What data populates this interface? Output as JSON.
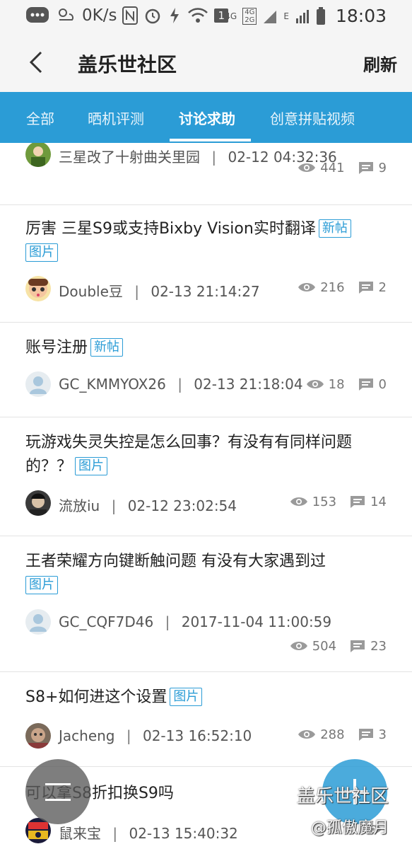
{
  "status_bar": {
    "speed": "0K/s",
    "sim_badge": "1",
    "net_4g": "4G",
    "net_4g_small": "4G",
    "net_2g_small": "2G",
    "net_e": "E",
    "time": "18:03"
  },
  "appbar": {
    "title": "盖乐世社区",
    "refresh_label": "刷新"
  },
  "tabs": [
    {
      "label": "全部",
      "active": false
    },
    {
      "label": "晒机评测",
      "active": false
    },
    {
      "label": "讨论求助",
      "active": true
    },
    {
      "label": "创意拼贴视频",
      "active": false
    }
  ],
  "posts": [
    {
      "title": "",
      "tags": [],
      "author": "三星改了十射曲关里园",
      "time": "02-12 04:32:36",
      "views": "441",
      "comments": "9"
    },
    {
      "title": "厉害 三星S9或支持Bixby Vision实时翻译",
      "tags": [
        "新帖",
        "图片"
      ],
      "author": "Double豆",
      "time": "02-13 21:14:27",
      "views": "216",
      "comments": "2"
    },
    {
      "title": "账号注册",
      "tags": [
        "新帖"
      ],
      "author": "GC_KMMYOX26",
      "time": "02-13 21:18:04",
      "views": "18",
      "comments": "0"
    },
    {
      "title": "玩游戏失灵失控是怎么回事？有没有有同样问题的？？",
      "tags": [
        "图片"
      ],
      "author": "流放iu",
      "time": "02-12 23:02:54",
      "views": "153",
      "comments": "14"
    },
    {
      "title": "王者荣耀方向键断触问题 有没有大家遇到过",
      "tags": [
        "图片"
      ],
      "author": "GC_CQF7D46",
      "time": "2017-11-04 11:00:59",
      "views": "504",
      "comments": "23"
    },
    {
      "title": "S8+如何进这个设置",
      "tags": [
        "图片"
      ],
      "author": "Jacheng",
      "time": "02-13 16:52:10",
      "views": "288",
      "comments": "3"
    },
    {
      "title": "可以拿S8折扣换S9吗",
      "tags": [],
      "author": "鼠来宝",
      "time": "02-13 15:40:32",
      "views": "",
      "comments": ""
    }
  ],
  "separator": "|",
  "watermark": {
    "line1": "盖乐世社区",
    "line2": "@孤傲魔月"
  },
  "colors": {
    "accent": "#2b9cd6",
    "appbar_bg": "#f5f5f5"
  },
  "icons": {
    "view": "eye-icon",
    "comment": "comment-icon",
    "back": "chevron-left-icon",
    "menu": "menu-icon",
    "add": "plus-icon"
  }
}
